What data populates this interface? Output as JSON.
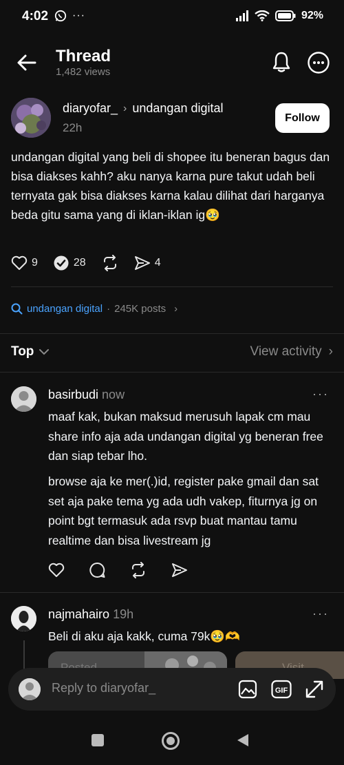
{
  "status": {
    "time": "4:02",
    "battery": "92%"
  },
  "header": {
    "title": "Thread",
    "views": "1,482 views"
  },
  "post": {
    "username": "diaryofar_",
    "topic": "undangan digital",
    "time": "22h",
    "follow_label": "Follow",
    "body": "undangan digital yang beli di shopee itu beneran bagus dan bisa diakses kahh? aku nanya karna pure takut udah beli ternyata gak bisa diakses karna kalau dilihat dari harganya beda gitu sama yang di iklan-iklan ig🥹",
    "likes": "9",
    "comments": "28",
    "shares": "4"
  },
  "topic_row": {
    "name": "undangan digital",
    "separator": "·",
    "count": "245K posts"
  },
  "sort": {
    "label": "Top",
    "view_activity": "View activity"
  },
  "replies": [
    {
      "username": "basirbudi",
      "time": "now",
      "para1": "maaf kak, bukan maksud merusuh lapak cm mau share info aja ada undangan digital yg beneran free dan siap tebar lho.",
      "para2": "browse aja ke mer(.)id, register pake gmail dan sat set aja pake tema yg ada udh vakep, fiturnya jg on point bgt termasuk ada rsvp buat mantau tamu realtime dan bisa livestream jg"
    },
    {
      "username": "najmahairo",
      "time": "19h",
      "text": "Beli di aku aja kakk, cuma 79k🥹🫶"
    }
  ],
  "preview": {
    "card1_label": "Posted",
    "card2_label": "Visit"
  },
  "reply_bar": {
    "placeholder": "Reply to diaryofar_"
  },
  "colors": {
    "background": "#101010",
    "accent": "#4aa3ff",
    "muted": "#8a8a8a"
  }
}
